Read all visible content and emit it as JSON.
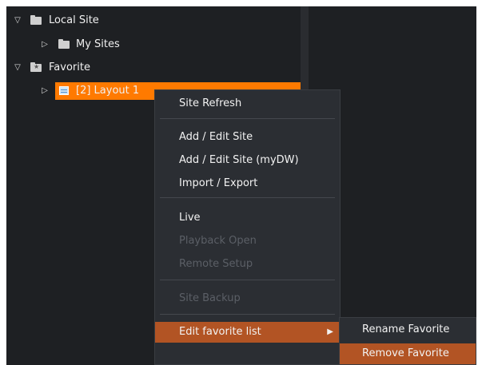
{
  "tree": {
    "items": [
      {
        "label": "Local Site",
        "icon": "folder-icon",
        "expanded": true
      },
      {
        "label": "My Sites",
        "icon": "folder-icon",
        "expanded": false
      },
      {
        "label": "Favorite",
        "icon": "favorite-folder-icon",
        "expanded": true
      },
      {
        "label": "[2] Layout 1",
        "icon": "layout-icon",
        "expanded": false,
        "selected": true
      }
    ]
  },
  "context_menu": {
    "items": [
      {
        "label": "Site Refresh",
        "enabled": true
      },
      {
        "label": "Add / Edit Site",
        "enabled": true
      },
      {
        "label": "Add / Edit Site (myDW)",
        "enabled": true
      },
      {
        "label": "Import / Export",
        "enabled": true
      },
      {
        "label": "Live",
        "enabled": true
      },
      {
        "label": "Playback Open",
        "enabled": false
      },
      {
        "label": "Remote Setup",
        "enabled": false
      },
      {
        "label": "Site Backup",
        "enabled": false
      },
      {
        "label": "Edit favorite list",
        "enabled": true,
        "highlighted": true
      }
    ]
  },
  "submenu": {
    "items": [
      {
        "label": "Rename Favorite",
        "highlighted": false
      },
      {
        "label": "Remove Favorite",
        "highlighted": true
      }
    ]
  },
  "colors": {
    "selection": "#ff7a00",
    "menu_highlight": "#b25424",
    "background": "#1e2023",
    "menu_background": "#2b2e33",
    "disabled_text": "#5b5f66"
  }
}
